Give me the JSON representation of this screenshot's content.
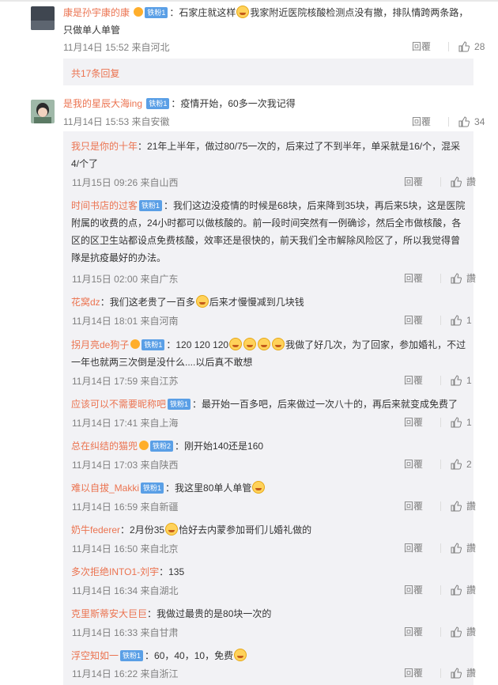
{
  "first_comment": {
    "user": "康是孙宇康的康",
    "badge": "铁粉1",
    "text_a": "：石家庄就这样",
    "text_b": "我家附近医院核酸检测点没有撤，排队情跨两条路，只做单人单管",
    "time": "11月14日 15:52 来自河北",
    "reply": "回覆",
    "likes": "28"
  },
  "more_replies": "共17条回复",
  "second_comment": {
    "user": "是我的星辰大海ing",
    "badge": "铁粉1",
    "text": "：疫情开始，60多一次我记得",
    "time": "11月14日 15:53 来自安徽",
    "reply": "回覆",
    "likes": "34"
  },
  "replies": [
    {
      "user": "我只是你的十年",
      "badge": "",
      "text": "：21年上半年，做过80/75一次的，后来过了不到半年，单采就是16/个，混采4/个了",
      "time": "11月15日 09:26 来自山西",
      "reply": "回覆",
      "likes": "讚"
    },
    {
      "user": "时间书店的过客",
      "badge": "铁粉1",
      "text": "：我们这边没疫情的时候是68块，后来降到35块，再后来5块，这是医院附属的收费的点，24小时都可以做核酸的。前一段时间突然有一例确诊，然后全市做核酸，各区的区卫生站都设点免费核酸，效率还是很快的，前天我们全市解除风险区了，所以我觉得曾隊是抗疫最好的办法。",
      "time": "11月15日 02:00 来自广东",
      "reply": "回覆",
      "likes": "讚"
    },
    {
      "user": "花窝dz",
      "badge": "",
      "text_a": "：我们这老贵了一百多",
      "text_b": "后来才慢慢减到几块钱",
      "time": "11月14日 18:01 来自河南",
      "reply": "回覆",
      "likes": "1"
    },
    {
      "user": "拐月亮de狗子",
      "badge": "铁粉1",
      "text_a": "：120 120 120",
      "text_b": "我做了好几次，为了回家，参加婚礼，不过一年也就两三次倒是没什么....以后真不敢想",
      "time": "11月14日 17:59 来自江苏",
      "reply": "回覆",
      "likes": "1"
    },
    {
      "user": "应该可以不需要昵称吧",
      "badge": "铁粉1",
      "text": "：最开始一百多吧，后来做过一次八十的，再后来就变成免费了",
      "time": "11月14日 17:41 来自上海",
      "reply": "回覆",
      "likes": "1"
    },
    {
      "user": "总在纠结的猫兜",
      "badge": "铁粉2",
      "text": "：刚开始140还是160",
      "time": "11月14日 17:03 来自陕西",
      "reply": "回覆",
      "likes": "2"
    },
    {
      "user": "难以自拔_Makki",
      "badge": "铁粉1",
      "text": "：我这里80单人单管",
      "time": "11月14日 16:59 来自新疆",
      "reply": "回覆",
      "likes": "讚"
    },
    {
      "user": "奶牛federer",
      "badge": "",
      "text_a": "：2月份35",
      "text_b": "恰好去内蒙参加哥们儿婚礼做的",
      "time": "11月14日 16:50 来自北京",
      "reply": "回覆",
      "likes": "讚"
    },
    {
      "user": "多次拒绝INTO1-刘宇",
      "badge": "",
      "text": "：135",
      "time": "11月14日 16:34 来自湖北",
      "reply": "回覆",
      "likes": "讚"
    },
    {
      "user": "克里斯蒂安大巨巨",
      "badge": "",
      "text": "：我做过最贵的是80块一次的",
      "time": "11月14日 16:33 来自甘肃",
      "reply": "回覆",
      "likes": "讚"
    },
    {
      "user": "浮空知如一",
      "badge": "铁粉1",
      "text": "：60，40，10，免费",
      "time": "11月14日 16:22 来自浙江",
      "reply": "回覆",
      "likes": "讚"
    }
  ],
  "colors": {
    "username": "#eb7350",
    "meta": "#808080",
    "panel": "#f2f2f5",
    "badge": "#5a9fe6"
  }
}
